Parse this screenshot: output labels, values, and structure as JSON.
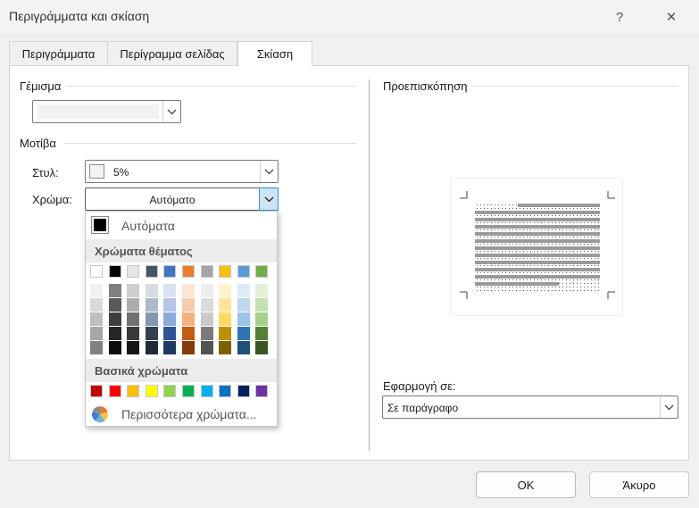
{
  "window": {
    "title": "Περιγράμματα και σκίαση",
    "help_label": "?",
    "close_label": "✕"
  },
  "tabs": [
    {
      "label": "Περιγράμματα"
    },
    {
      "label": "Περίγραμμα σελίδας"
    },
    {
      "label": "Σκίαση"
    }
  ],
  "active_tab": "Σκίαση",
  "fill": {
    "heading": "Γέμισμα",
    "value": ""
  },
  "patterns": {
    "heading": "Μοτίβα",
    "style_label": "Στυλ:",
    "style_value": "5%",
    "color_label": "Χρώμα:",
    "color_value": "Αυτόματο"
  },
  "color_menu": {
    "automatic_label": "Αυτόματα",
    "theme_heading": "Χρώματα θέματος",
    "standard_heading": "Βασικά χρώματα",
    "more_label": "Περισσότερα χρώματα...",
    "theme_colors": [
      "#ffffff",
      "#000000",
      "#e7e6e6",
      "#44546a",
      "#4472c4",
      "#ed7d31",
      "#a5a5a5",
      "#ffc000",
      "#5b9bd5",
      "#70ad47"
    ],
    "theme_shades": [
      [
        "#f2f2f2",
        "#d9d9d9",
        "#bfbfbf",
        "#a6a6a6",
        "#808080"
      ],
      [
        "#7f7f7f",
        "#595959",
        "#3f3f3f",
        "#262626",
        "#0d0d0d"
      ],
      [
        "#d0cece",
        "#aeabab",
        "#757070",
        "#3b3838",
        "#161616"
      ],
      [
        "#d6dce4",
        "#adb9ca",
        "#8496b0",
        "#333f4f",
        "#222a35"
      ],
      [
        "#d9e2f3",
        "#b4c6e7",
        "#8eaadb",
        "#2f5496",
        "#1f3864"
      ],
      [
        "#fbe5d5",
        "#f7cbac",
        "#f4b183",
        "#c55a11",
        "#833c0b"
      ],
      [
        "#ededed",
        "#dbdbdb",
        "#c9c9c9",
        "#7b7b7b",
        "#525252"
      ],
      [
        "#fff2cc",
        "#ffe599",
        "#ffd966",
        "#bf9000",
        "#7f6000"
      ],
      [
        "#deebf6",
        "#bdd7ee",
        "#9cc3e5",
        "#2e75b5",
        "#1f4e79"
      ],
      [
        "#e2efd9",
        "#c5e0b3",
        "#a8d08d",
        "#538135",
        "#375623"
      ]
    ],
    "standard_colors": [
      "#c00000",
      "#ff0000",
      "#ffc000",
      "#ffff00",
      "#92d050",
      "#00b050",
      "#00b0f0",
      "#0070c0",
      "#002060",
      "#7030a0"
    ]
  },
  "preview": {
    "heading": "Προεπισκόπηση"
  },
  "apply_to": {
    "label": "Εφαρμογή σε:",
    "value": "Σε παράγραφο"
  },
  "buttons": {
    "ok": "OK",
    "cancel": "Άκυρο"
  }
}
